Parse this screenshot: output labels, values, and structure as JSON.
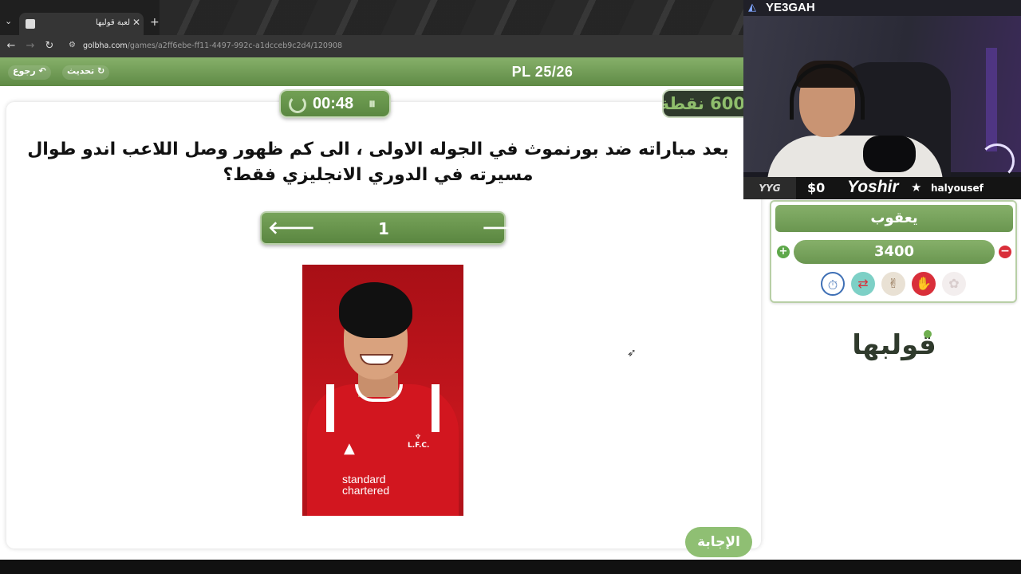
{
  "browser": {
    "tab_title": "لعبة قولبها",
    "url_host": "golbha.com",
    "url_path": "/games/a2ff6ebe-ff11-4497-992c-a1dcceb9c2d4/120908"
  },
  "header": {
    "back_label": "رجوع",
    "refresh_label": "تحديث",
    "title": "PL 25/26"
  },
  "timer": {
    "time": "00:48"
  },
  "points": {
    "label": "600 نقطة"
  },
  "question": {
    "text": "بعد مباراته ضد بورنموث في الجوله الاولى ، الى كم ظهور وصل اللاعب اندو طوال مسيرته في الدوري الانجليزي فقط؟"
  },
  "stepper": {
    "value": "1"
  },
  "player_image": {
    "crest_text": "L.F.C.",
    "sponsor_line1": "standard",
    "sponsor_line2": "chartered"
  },
  "answer_button": {
    "label": "الإجابة"
  },
  "stream": {
    "channel_name": "YE3GAH",
    "logo": "YYG",
    "money": "$0",
    "streamer": "Yoshir",
    "username": "halyousef"
  },
  "team": {
    "name": "يعقوب",
    "score": "3400",
    "powerups": [
      "stopwatch-icon",
      "swap-icon",
      "peace-hand-icon",
      "stop-hand-icon",
      "disabled-powerup-icon"
    ]
  },
  "brand": {
    "logo_text": "قولبها"
  },
  "colors": {
    "accent_green": "#6a9650",
    "dark_panel": "#2f3a2c",
    "minus_red": "#d92f3a"
  }
}
